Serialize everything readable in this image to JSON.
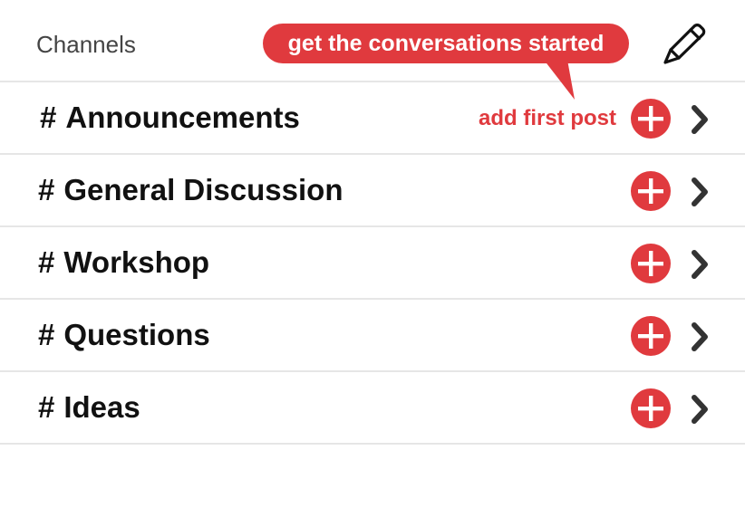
{
  "header": {
    "title": "Channels",
    "tooltip": "get the conversations started"
  },
  "channels": [
    {
      "hash": "#",
      "name": "Announcements",
      "hint": "add first post"
    },
    {
      "hash": "#",
      "name": "General Discussion",
      "hint": ""
    },
    {
      "hash": "#",
      "name": "Workshop",
      "hint": ""
    },
    {
      "hash": "#",
      "name": "Questions",
      "hint": ""
    },
    {
      "hash": "#",
      "name": "Ideas",
      "hint": ""
    }
  ],
  "icons": {
    "edit": "pencil-icon",
    "add": "plus-circle-icon",
    "open": "chevron-right-icon"
  },
  "colors": {
    "accent": "#e03a3e",
    "text": "#111111",
    "muted": "#444444",
    "divider": "#e6e6e6",
    "chevron": "#333333"
  }
}
